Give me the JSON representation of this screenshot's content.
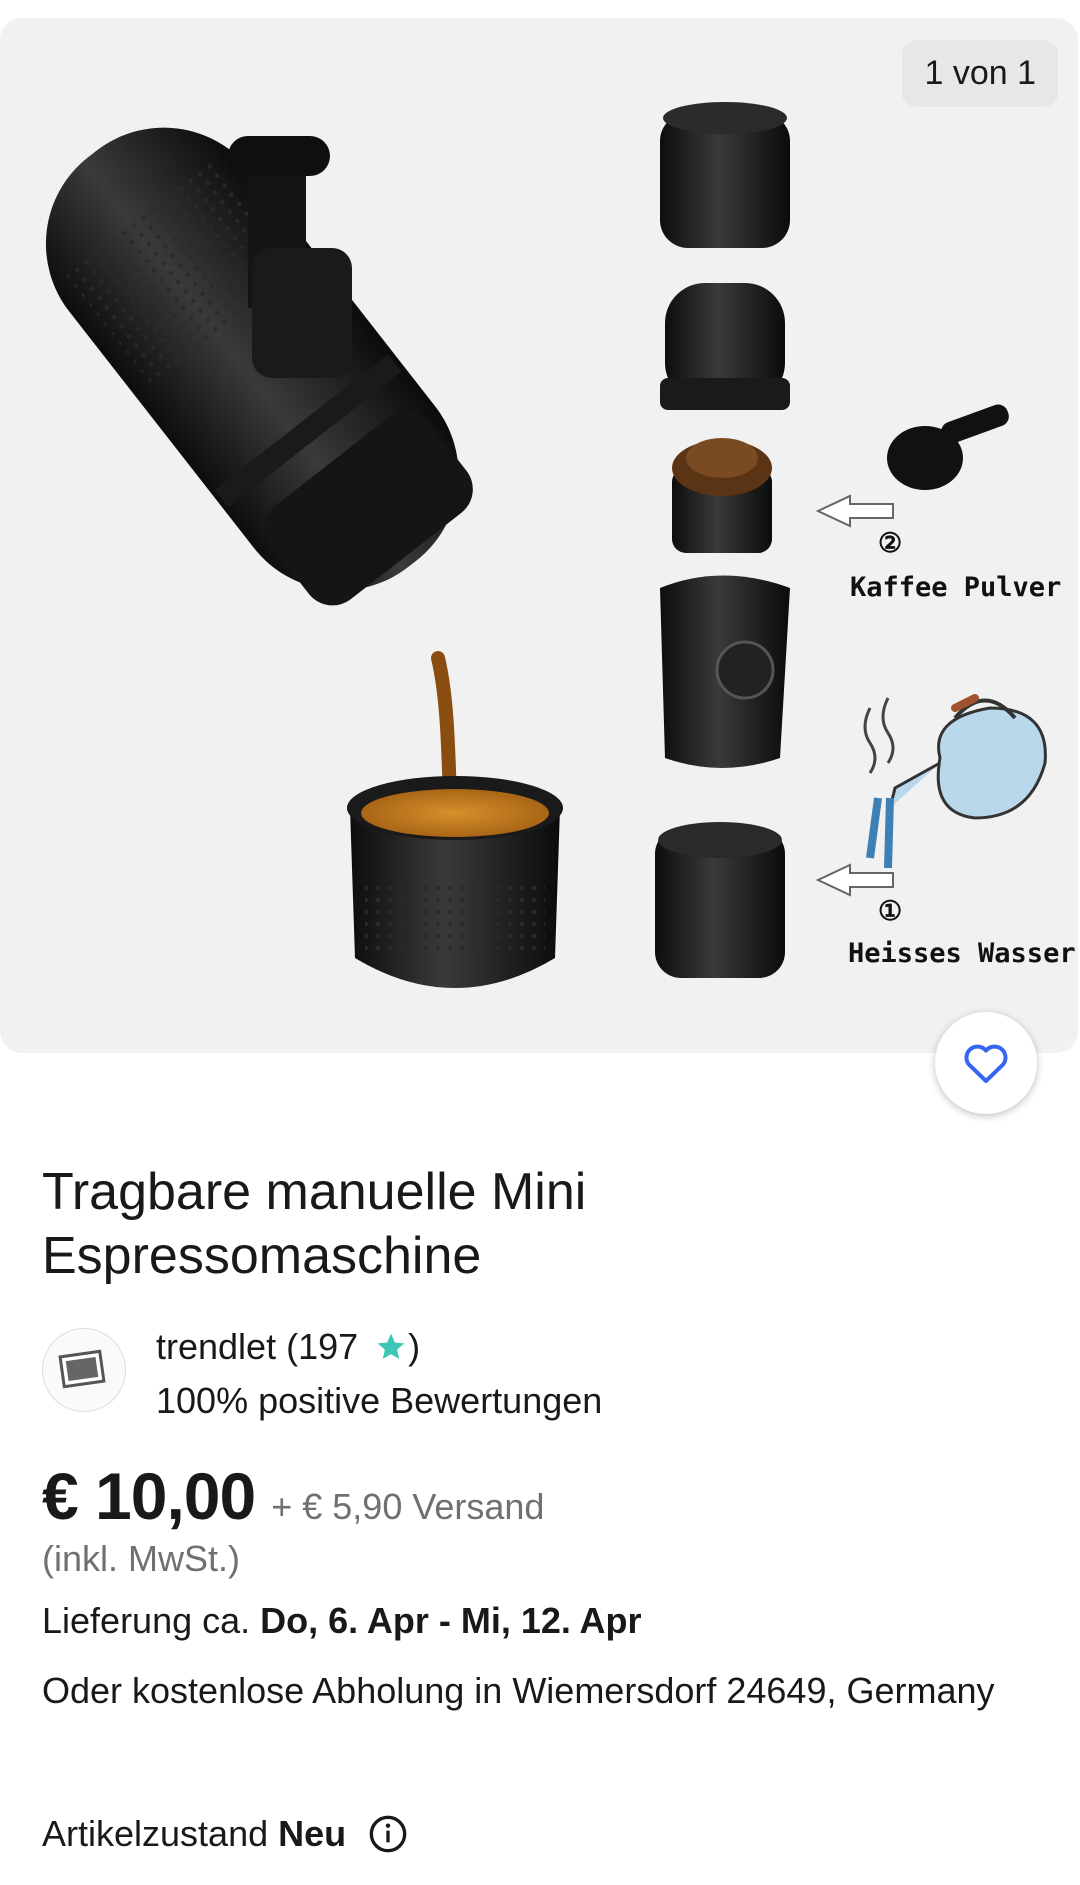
{
  "gallery": {
    "counter": "1 von 1",
    "annotations": {
      "step2_number": "②",
      "step2_label": "Kaffee Pulver",
      "step1_number": "①",
      "step1_label": "Heisses Wasser"
    }
  },
  "favorite": {
    "icon": "heart-icon"
  },
  "product": {
    "title": "Tragbare manuelle Mini Espressomaschine"
  },
  "seller": {
    "name_prefix": "trendlet (197",
    "name_suffix": ")",
    "rating": "100% positive Bewertungen",
    "star_color": "#3bc6b8"
  },
  "pricing": {
    "price": "€ 10,00",
    "shipping": "+ € 5,90 Versand",
    "tax_note": "(inkl. MwSt.)"
  },
  "delivery": {
    "prefix": "Lieferung ca.",
    "dates": "Do, 6. Apr - Mi, 12. Apr"
  },
  "pickup": {
    "text": "Oder kostenlose Abholung in Wiemersdorf 24649, Germany"
  },
  "condition": {
    "label": "Artikelzustand",
    "value": "Neu",
    "icon": "info-icon"
  }
}
